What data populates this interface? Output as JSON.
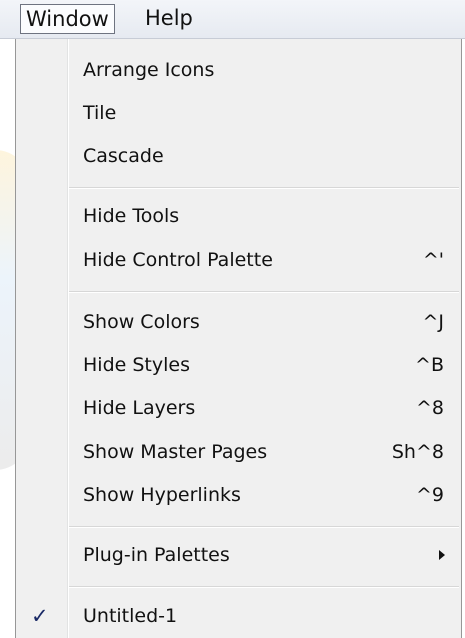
{
  "menubar": {
    "window_label": "Window",
    "help_label": "Help"
  },
  "menu": {
    "arrange_icons": "Arrange Icons",
    "tile": "Tile",
    "cascade": "Cascade",
    "hide_tools": "Hide Tools",
    "hide_control_palette": "Hide Control Palette",
    "hide_control_palette_shortcut": "^'",
    "show_colors": "Show Colors",
    "show_colors_shortcut": "^J",
    "hide_styles": "Hide Styles",
    "hide_styles_shortcut": "^B",
    "hide_layers": "Hide Layers",
    "hide_layers_shortcut": "^8",
    "show_master_pages": "Show Master Pages",
    "show_master_pages_shortcut": "Sh^8",
    "show_hyperlinks": "Show Hyperlinks",
    "show_hyperlinks_shortcut": "^9",
    "plugin_palettes": "Plug-in Palettes",
    "untitled": "Untitled-1",
    "untitled_checked": true
  },
  "icons": {
    "submenu_arrow": "chevron-right-icon",
    "check": "checkmark-icon"
  },
  "colors": {
    "menu_bg": "#f0f0f0",
    "menubar_bg": "#e9ecf2",
    "check_color": "#1a2a66"
  }
}
